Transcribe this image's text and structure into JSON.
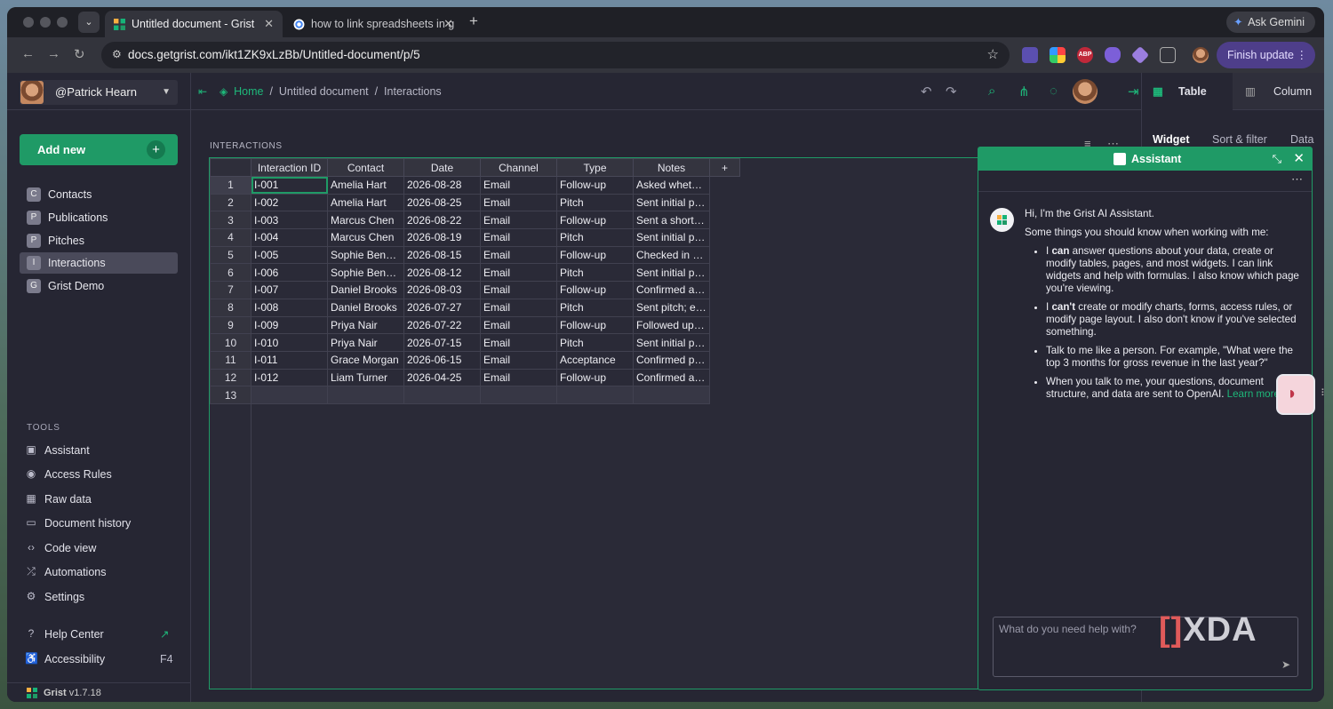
{
  "browser": {
    "tabs": [
      {
        "title": "Untitled document - Grist",
        "active": true
      },
      {
        "title": "how to link spreadsheets in g",
        "active": false
      }
    ],
    "gemini_label": "Ask Gemini",
    "url": "docs.getgrist.com/ikt1ZK9xLzBb/Untitled-document/p/5",
    "finish_update_label": "Finish update",
    "extension_icons": [
      "readwise-icon",
      "colorful-pinwheel-icon",
      "adblock-plus-icon",
      "obsidian-icon",
      "diamond-icon",
      "puzzle-extensions-icon"
    ]
  },
  "sidebar": {
    "username": "@Patrick Hearn",
    "add_new_label": "Add new",
    "pages": [
      {
        "initial": "C",
        "label": "Contacts"
      },
      {
        "initial": "P",
        "label": "Publications"
      },
      {
        "initial": "P",
        "label": "Pitches"
      },
      {
        "initial": "I",
        "label": "Interactions",
        "selected": true
      },
      {
        "initial": "G",
        "label": "Grist Demo"
      }
    ],
    "tools_heading": "TOOLS",
    "tools": [
      {
        "icon": "assistant-icon",
        "label": "Assistant"
      },
      {
        "icon": "eye-icon",
        "label": "Access Rules"
      },
      {
        "icon": "table-icon",
        "label": "Raw data"
      },
      {
        "icon": "folder-icon",
        "label": "Document history"
      },
      {
        "icon": "code-icon",
        "label": "Code view"
      },
      {
        "icon": "automation-icon",
        "label": "Automations"
      },
      {
        "icon": "gear-icon",
        "label": "Settings"
      }
    ],
    "help_center_label": "Help Center",
    "accessibility_label": "Accessibility",
    "accessibility_shortcut": "F4",
    "version_brand": "Grist",
    "version": "v1.7.18"
  },
  "header": {
    "breadcrumb_home": "Home",
    "breadcrumb_sep": "/",
    "breadcrumb_doc": "Untitled document",
    "breadcrumb_page": "Interactions"
  },
  "section": {
    "title": "INTERACTIONS",
    "columns": [
      "Interaction ID",
      "Contact",
      "Date",
      "Channel",
      "Type",
      "Notes"
    ],
    "add_column_label": "+",
    "rows": [
      [
        "1",
        "I-001",
        "Amelia Hart",
        "2026-08-28",
        "Email",
        "Follow-up",
        "Asked wheth…"
      ],
      [
        "2",
        "I-002",
        "Amelia Hart",
        "2026-08-25",
        "Email",
        "Pitch",
        "Sent initial pit…"
      ],
      [
        "3",
        "I-003",
        "Marcus Chen",
        "2026-08-22",
        "Email",
        "Follow-up",
        "Sent a short f…"
      ],
      [
        "4",
        "I-004",
        "Marcus Chen",
        "2026-08-19",
        "Email",
        "Pitch",
        "Sent initial pit…"
      ],
      [
        "5",
        "I-005",
        "Sophie Bennett",
        "2026-08-15",
        "Email",
        "Follow-up",
        "Checked in o…"
      ],
      [
        "6",
        "I-006",
        "Sophie Bennett",
        "2026-08-12",
        "Email",
        "Pitch",
        "Sent initial pit…"
      ],
      [
        "7",
        "I-007",
        "Daniel Brooks",
        "2026-08-03",
        "Email",
        "Follow-up",
        "Confirmed as…"
      ],
      [
        "8",
        "I-008",
        "Daniel Brooks",
        "2026-07-27",
        "Email",
        "Pitch",
        "Sent pitch; ed…"
      ],
      [
        "9",
        "I-009",
        "Priya Nair",
        "2026-07-22",
        "Email",
        "Follow-up",
        "Followed up …"
      ],
      [
        "10",
        "I-010",
        "Priya Nair",
        "2026-07-15",
        "Email",
        "Pitch",
        "Sent initial pit…"
      ],
      [
        "11",
        "I-011",
        "Grace Morgan",
        "2026-06-15",
        "Email",
        "Acceptance",
        "Confirmed pu…"
      ],
      [
        "12",
        "I-012",
        "Liam Turner",
        "2026-04-25",
        "Email",
        "Follow-up",
        "Confirmed art…"
      ]
    ],
    "new_row_number": "13"
  },
  "right_panel": {
    "tab_table": "Table",
    "tab_column": "Column",
    "sub_widget": "Widget",
    "sub_sort": "Sort & filter",
    "sub_data": "Data"
  },
  "assistant": {
    "title": "Assistant",
    "greeting": "Hi, I'm the Grist AI Assistant.",
    "intro": "Some things you should know when working with me:",
    "can_prefix": "I ",
    "can_word": "can",
    "can_text": " answer questions about your data, create or modify tables, pages, and most widgets. I can link widgets and help with formulas. I also know which page you're viewing.",
    "cant_prefix": "I ",
    "cant_word": "can't",
    "cant_text": " create or modify charts, forms, access rules, or modify page layout. I also don't know if you've selected something.",
    "talk_text": "Talk to me like a person. For example, \"What were the top 3 months for gross revenue in the last year?\"",
    "privacy_text": "When you talk to me, your questions, document structure, and data are sent to OpenAI. ",
    "learn_more": "Learn more",
    "input_placeholder": "What do you need help with?"
  },
  "watermark": "XDA",
  "colors": {
    "accent": "#1f9a66",
    "link": "#1eb87a",
    "background": "#262633",
    "finish_update_bg": "#4e3e8a"
  }
}
